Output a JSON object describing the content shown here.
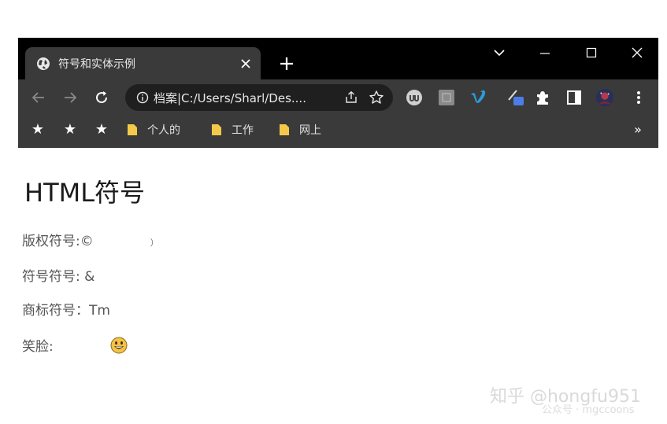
{
  "browser": {
    "tab_title": "符号和实体示例",
    "address_text": "档案|C:/Users/Sharl/Des....",
    "bookmarks": [
      "个人的",
      "工作",
      "网上"
    ],
    "bookmark_stars": [
      "★",
      "★",
      "★"
    ],
    "more_bookmarks": "»"
  },
  "page": {
    "title": "HTML符号",
    "lines": [
      {
        "label": "版权符号:",
        "symbol": "©",
        "trail": "）"
      },
      {
        "label": "符号符号: ",
        "symbol": "&"
      },
      {
        "label": "商标符号：",
        "symbol": "Tm"
      },
      {
        "label": "笑脸:"
      }
    ]
  },
  "watermark": {
    "main": "知乎 @hongfu951",
    "sub": "公众号 · mgccoons"
  },
  "colors": {
    "tabstrip": "#000000",
    "chrome": "#3a3a3a",
    "omnibox": "#1f1f1f",
    "folder": "#f4c94a",
    "text": "#555555"
  }
}
